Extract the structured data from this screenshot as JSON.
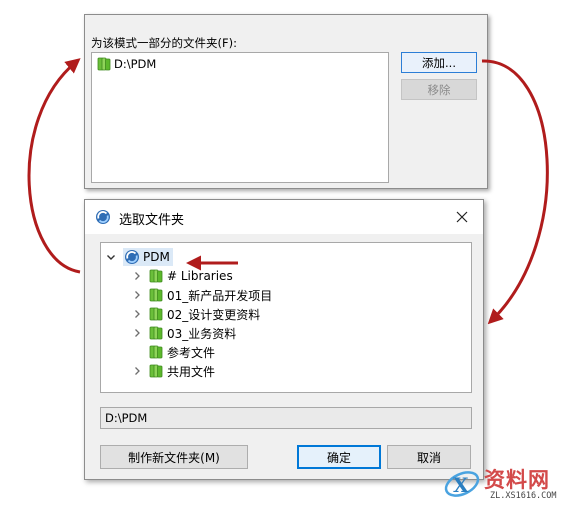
{
  "top_panel": {
    "label": "为该模式一部分的文件夹(F):",
    "folders": [
      "D:\\PDM"
    ],
    "add_label": "添加...",
    "remove_label": "移除"
  },
  "dialog": {
    "title": "选取文件夹",
    "tree": {
      "root": "PDM",
      "children": [
        {
          "label": "# Libraries",
          "expandable": true
        },
        {
          "label": "01_新产品开发项目",
          "expandable": true
        },
        {
          "label": "02_设计变更资料",
          "expandable": true
        },
        {
          "label": "03_业务资料",
          "expandable": true
        },
        {
          "label": "参考文件",
          "expandable": false
        },
        {
          "label": "共用文件",
          "expandable": true
        }
      ]
    },
    "path_value": "D:\\PDM",
    "new_folder_label": "制作新文件夹(M)",
    "ok_label": "确定",
    "cancel_label": "取消"
  },
  "watermark": {
    "text": "资料网",
    "url": "ZL.XS1616.COM"
  },
  "colors": {
    "annotation_arrow": "#b01c1c",
    "folder_green": "#5cb82c",
    "selection": "#dbe9f7",
    "accent_border": "#0078d7"
  },
  "icons": {
    "folder": "folder-icon",
    "pdm_vault": "pdm-vault-icon",
    "close": "close-icon",
    "expand": "chevron-right-icon",
    "collapse": "chevron-down-icon"
  }
}
